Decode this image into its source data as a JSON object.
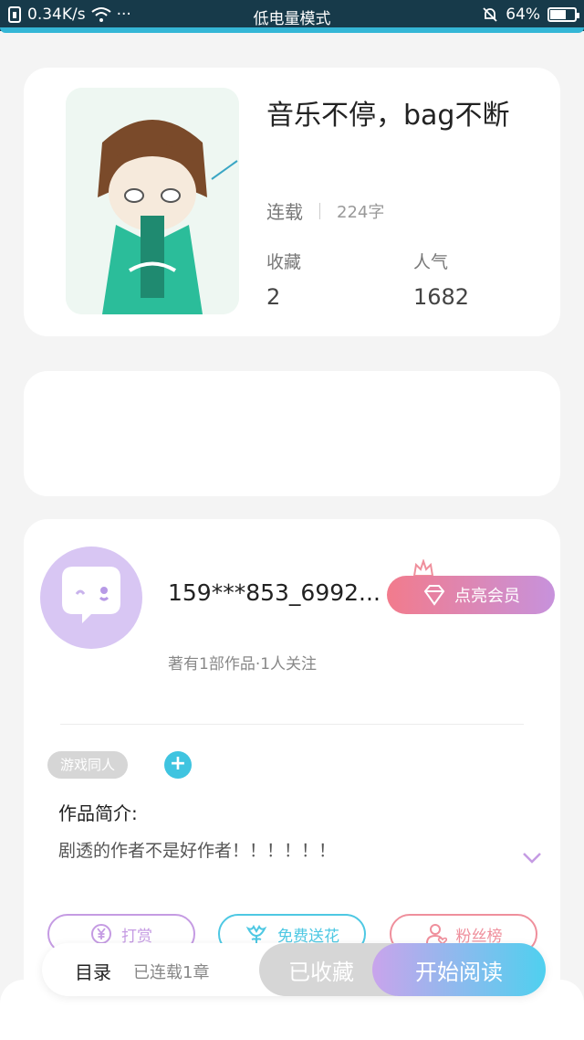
{
  "status_bar": {
    "speed": "0.34K/s",
    "dots": "···",
    "mode": "低电量模式",
    "battery": "64%",
    "battery_level": 0.64
  },
  "book": {
    "title": "音乐不停，bag不断",
    "status": "连载",
    "words": "224字",
    "favorites_label": "收藏",
    "favorites_value": "2",
    "popularity_label": "人气",
    "popularity_value": "1682"
  },
  "author": {
    "name": "159***853_6992...",
    "vip_label": "点亮会员",
    "stats": "著有1部作品·1人关注",
    "tag": "游戏同人",
    "add_tag": "+",
    "intro_heading": "作品简介:",
    "intro_text": "剧透的作者不是好作者！！！！！！"
  },
  "actions": {
    "tip_label": "打赏",
    "flower_label": "免费送花",
    "fans_label": "粉丝榜"
  },
  "bottom_bar": {
    "toc_label": "目录",
    "toc_count": "已连载1章",
    "collected_label": "已收藏",
    "read_label": "开始阅读"
  },
  "colors": {
    "status_bar_bg": "#173a4a",
    "accent_cyan": "#4ec8e3",
    "accent_purple": "#c59be3",
    "accent_pink": "#ef8f9c"
  },
  "icons": [
    "sim-icon",
    "wifi-icon",
    "mute-bell-icon",
    "battery-icon",
    "gem-icon",
    "crown-icon",
    "chevron-down-icon",
    "yen-coin-icon",
    "flower-icon",
    "fans-icon",
    "chat-avatar-icon"
  ]
}
